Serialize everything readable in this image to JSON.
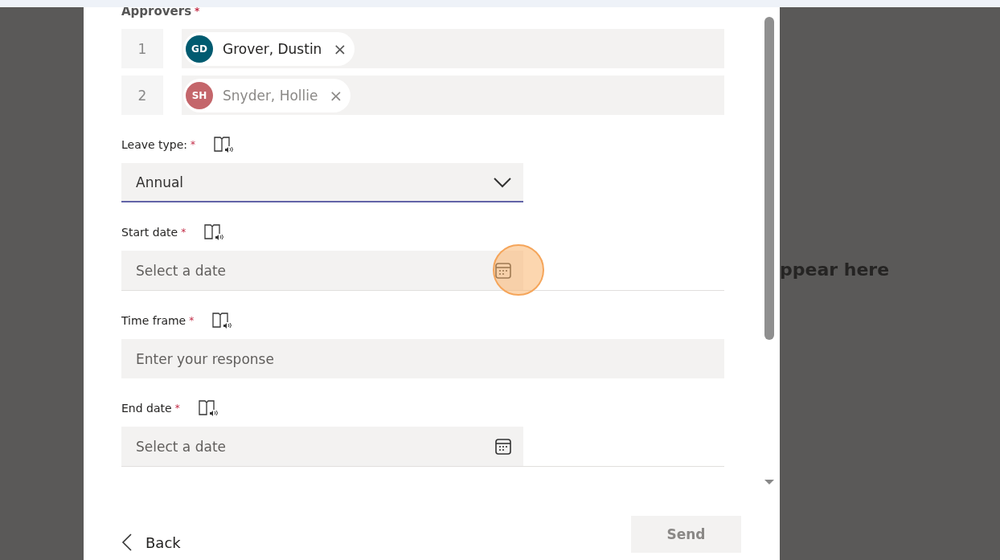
{
  "form": {
    "approvers_label": "Approvers",
    "required_mark": "*",
    "approvers": [
      {
        "number": "1",
        "initials": "GD",
        "name": "Grover, Dustin",
        "color": "#005b70",
        "remove": "×",
        "faded": false
      },
      {
        "number": "2",
        "initials": "SH",
        "name": "Snyder, Hollie",
        "color": "#c4666b",
        "remove": "×",
        "faded": true
      }
    ],
    "fields": [
      {
        "kind": "select",
        "label": "Leave type:",
        "required": true,
        "value": "Annual",
        "focused": true
      },
      {
        "kind": "date",
        "label": "Start date",
        "required": true,
        "placeholder": "Select a date",
        "highlighted": true
      },
      {
        "kind": "text",
        "label": "Time frame",
        "required": true,
        "placeholder": "Enter your response"
      },
      {
        "kind": "date",
        "label": "End date",
        "required": true,
        "placeholder": "Select a date",
        "highlighted": false
      }
    ]
  },
  "footer": {
    "back": "Back",
    "send": "Send",
    "send_disabled": true
  },
  "background_text": "ppear here"
}
